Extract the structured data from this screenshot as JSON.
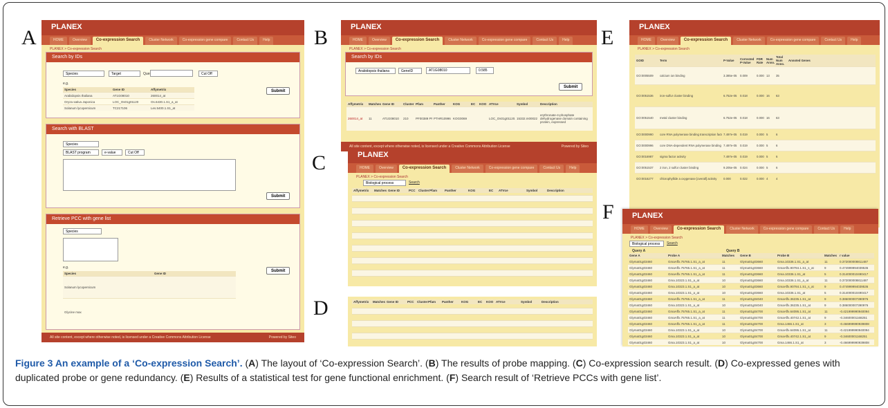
{
  "app": {
    "brand": "PLANEX",
    "footer_left": "All site content, except where otherwise noted, is licensed under a Creative Commons Attribution License",
    "footer_right": "Powered by Siteo"
  },
  "tabs": [
    "HOME",
    "Overview",
    "Co-expression Search",
    "Cluster Network",
    "Co-expression gene compare",
    "Contact Us",
    "Help"
  ],
  "breadcrumb": "PLANEX > Co-expression Search",
  "panel_labels": {
    "a": "A",
    "b": "B",
    "c": "C",
    "d": "D",
    "e": "E",
    "f": "F"
  },
  "panel_a": {
    "search_ids_title": "Search by IDs",
    "species_select": "Species",
    "target_select": "Target",
    "query_label": "Query",
    "cutoff_select": "Cut Off",
    "eg_label": "e.g.",
    "eg_headers": [
      "Species",
      "Gene ID",
      "Affymetrix"
    ],
    "eg_rows": [
      [
        "Arabidopsis thaliana",
        "AT1G08010",
        "260014_at"
      ],
      [
        "Oryza sativa Japonica",
        "LOC_Os01g01120",
        "Os.6430.1.S1_a_at"
      ],
      [
        "Solanum lycopersicum",
        "TC217106",
        "Les.5400.1.S1_at"
      ]
    ],
    "submit": "Submit",
    "blast_title": "Search with BLAST",
    "blast_program": "BLAST program",
    "evalue": "e-value",
    "pcc_title": "Retrieve PCC with gene list",
    "pcc_headers": [
      "Species",
      "Gene ID"
    ],
    "pcc_rows": [
      [
        "Solanum lycopersicum",
        ""
      ],
      [
        "Glycine max",
        ""
      ]
    ]
  },
  "panel_b": {
    "title": "Search by IDs",
    "species_value": "Arabidopsis thaliana",
    "target_value": "GeneID",
    "query_value": "AT1G08010",
    "cutoff_value": "0.585",
    "submit": "Submit",
    "headers": [
      "Affymetrix",
      "Matches",
      "Gene ID",
      "Cluster",
      "Pfam",
      "Panther",
      "KOG",
      "EC",
      "KOO",
      "ATVce",
      "Symbol",
      "Description"
    ],
    "row": [
      "260014_at",
      "11",
      "AT1G08010",
      "210",
      "PF00389 PF02826",
      "PTHR10996",
      "KOG0069",
      "",
      "",
      "LOC_Os01g01120.1",
      "15332.m00022",
      "erythronate-4-phosphate dehydrogenase domain containing protein, expressed"
    ]
  },
  "panel_c": {
    "filter_select": "Biological process",
    "filter_button": "Search",
    "headers": [
      "Affymetrix",
      "Matches",
      "Gene ID",
      "PCC",
      "Cluster",
      "Pfam",
      "Panther",
      "KOG",
      "EC",
      "ATVce",
      "Symbol",
      "Description"
    ]
  },
  "panel_d": {
    "headers": [
      "Affymetrix",
      "Matches",
      "Gene ID",
      "PCC",
      "Cluster",
      "Pfam",
      "Panther",
      "KOG",
      "EC",
      "KOO",
      "ATVce",
      "Symbol",
      "Description"
    ]
  },
  "panel_e": {
    "headers": [
      "GOID",
      "Term",
      "P-Value",
      "Corrected P-Value",
      "FDR Rate",
      "Num Anno.",
      "Total Num Anno.",
      "Annoted Genes"
    ],
    "rows": [
      [
        "GO:0005509",
        "calcium ion binding",
        "3.385e-05",
        "0.009",
        "0.000",
        "13",
        "35"
      ],
      [
        "GO:0051536",
        "iron-sulfur cluster binding",
        "6.752e-05",
        "0.018",
        "0.000",
        "16",
        "63"
      ],
      [
        "GO:0051540",
        "metal cluster binding",
        "6.752e-05",
        "0.018",
        "0.000",
        "16",
        "63"
      ],
      [
        "GO:0000990",
        "core RNA polymerase binding transcription factor activity",
        "7.497e-05",
        "0.019",
        "0.000",
        "5",
        "6"
      ],
      [
        "GO:0000996",
        "core DNA-dependent RNA polymerase binding promoter specificity activity",
        "7.497e-05",
        "0.019",
        "0.000",
        "5",
        "6"
      ],
      [
        "GO:0016987",
        "sigma factor activity",
        "7.497e-05",
        "0.019",
        "0.000",
        "5",
        "6"
      ],
      [
        "GO:0051537",
        "2 iron, 2 sulfur cluster binding",
        "9.205e-05",
        "0.024",
        "0.000",
        "5",
        "6"
      ],
      [
        "GO:0016277",
        "chlorophyllide a oxygenase [overall] activity",
        "0.000",
        "0.022",
        "0.000",
        "4",
        "4"
      ]
    ]
  },
  "panel_f": {
    "filter_select": "Biological process",
    "filter_button": "Search",
    "group_a": "Query A",
    "group_b": "Query B",
    "headers": [
      "Gene A",
      "Probe A",
      "Matches",
      "Gene B",
      "Probe B",
      "Matches",
      "r value"
    ],
    "rows": [
      [
        "Glyma01g03460",
        "GmaAffx.75765.1.S1_a_at",
        "11",
        "Glyma01g03660",
        "Gma.10336.1.S1_a_at",
        "11",
        "0.372000008811487"
      ],
      [
        "Glyma01g03460",
        "GmaAffx.75765.1.S1_a_at",
        "11",
        "Glyma01g03660",
        "GmaAffx.90784.1.S1_s_at",
        "9",
        "0.474999994039536"
      ],
      [
        "Glyma01g03460",
        "GmaAffx.75765.1.S1_a_at",
        "11",
        "Glyma01g03660",
        "Gma.10336.1.S1_at",
        "5",
        "0.314000010490417"
      ],
      [
        "Glyma01g03460",
        "Gma.10323.1.S1_a_at",
        "10",
        "Glyma01g03660",
        "Gma.10336.1.S1_a_at",
        "11",
        "0.372000008811487"
      ],
      [
        "Glyma01g03460",
        "Gma.10323.1.S1_a_at",
        "10",
        "Glyma01g03660",
        "GmaAffx.90784.1.S1_s_at",
        "9",
        "0.474999994039536"
      ],
      [
        "Glyma01g03460",
        "Gma.10323.1.S1_a_at",
        "10",
        "Glyma01g03660",
        "Gma.10336.1.S1_at",
        "5",
        "0.314000010490417"
      ],
      [
        "Glyma01g03460",
        "GmaAffx.75765.1.S1_a_at",
        "11",
        "Glyma01g04040",
        "GmaAffx.36235.1.S1_at",
        "9",
        "0.386000007390976"
      ],
      [
        "Glyma01g03460",
        "Gma.10323.1.S1_a_at",
        "10",
        "Glyma01g04040",
        "GmaAffx.36235.1.S1_at",
        "9",
        "0.386000007390976"
      ],
      [
        "Glyma01g03460",
        "GmaAffx.75765.1.S1_a_at",
        "11",
        "Glyma01g04700",
        "GmaAffx.64095.1.S1_at",
        "11",
        "-0.421999990940094"
      ],
      [
        "Glyma01g03460",
        "GmaAffx.75765.1.S1_a_at",
        "11",
        "Glyma01g04700",
        "GmaAffx.40742.1.S1_at",
        "9",
        "-0.34600001168251"
      ],
      [
        "Glyma01g03460",
        "GmaAffx.75765.1.S1_a_at",
        "11",
        "Glyma01g04700",
        "Gma.1466.1.S1_at",
        "3",
        "-0.466999990939808"
      ],
      [
        "Glyma01g03460",
        "Gma.10323.1.S1_a_at",
        "10",
        "Glyma01g04700",
        "GmaAffx.64095.1.S1_at",
        "11",
        "-0.421999990940094"
      ],
      [
        "Glyma01g03460",
        "Gma.10323.1.S1_a_at",
        "10",
        "Glyma01g04700",
        "GmaAffx.40742.1.S1_at",
        "9",
        "-0.34600001168251"
      ],
      [
        "Glyma01g03460",
        "Gma.10323.1.S1_a_at",
        "10",
        "Glyma01g04700",
        "Gma.1466.1.S1_at",
        "3",
        "-0.466999990939808"
      ]
    ]
  },
  "caption": {
    "title": "Figure 3 An example of a ‘Co-expression Search’.",
    "l_a": "A",
    "t_a": "The layout of ‘Co-expression Search’.",
    "l_b": "B",
    "t_b": "The results of probe mapping.",
    "l_c": "C",
    "t_c": "Co-expression search result.",
    "l_d": "D",
    "t_d": "Co-expressed genes with duplicated probe or gene redundancy.",
    "l_e": "E",
    "t_e": "Results of a statistical test for gene functional enrichment.",
    "l_f": "F",
    "t_f": "Search result of ‘Retrieve PCCs with gene list’."
  }
}
